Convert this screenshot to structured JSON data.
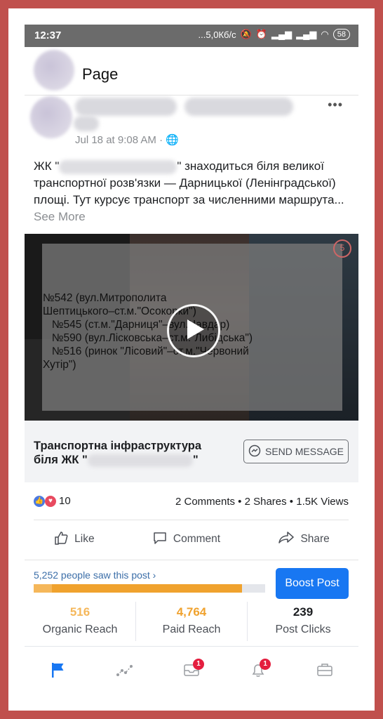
{
  "status_bar": {
    "time": "12:37",
    "net_speed": "...5,0Кб/с",
    "battery": "58"
  },
  "page": {
    "title": "Page"
  },
  "post": {
    "timestamp": "Jul 18 at 9:08 AM · ",
    "text_prefix": "ЖК \"",
    "text_body": "\" знаходиться біля великої транспортної розв'язки — Дарницької (Ленінградської) площі. Тут курсує транспорт за численними маршрута...",
    "see_more": "See More"
  },
  "video": {
    "overlay_text": "№542 (вул.Митрополита\nШептицького–ст.м.\"Осокорки\")\n   №545 (ст.м.\"Дарниця\"–вул.Чавдар)\n   №590 (вул.Лісковська–ст.м.\"Либідська\")\n   №516 (ринок \"Лісовий\"–ст.м.\"Червоний\nХутір\")",
    "corner_badge": "5"
  },
  "cta": {
    "title_line1": "Транспортна інфраструктура",
    "title_line2_prefix": "біля ЖК \"",
    "title_line2_suffix": "\"",
    "button_label": "SEND MESSAGE"
  },
  "engagement": {
    "reaction_count": "10",
    "stats": "2 Comments • 2 Shares • 1.5K Views"
  },
  "actions": {
    "like": "Like",
    "comment": "Comment",
    "share": "Share"
  },
  "insights": {
    "people_saw": "5,252 people saw this post",
    "boost_label": "Boost Post",
    "organic_fraction": 0.08,
    "paid_fraction": 0.9,
    "organic_value": "516",
    "organic_label": "Organic Reach",
    "paid_value": "4,764",
    "paid_label": "Paid Reach",
    "clicks_value": "239",
    "clicks_label": "Post Clicks",
    "organic_color": "#f5b75a",
    "paid_color": "#f0a22e",
    "accent_color": "#1877f2"
  },
  "nav": {
    "inbox_badge": "1",
    "notifications_badge": "1"
  }
}
